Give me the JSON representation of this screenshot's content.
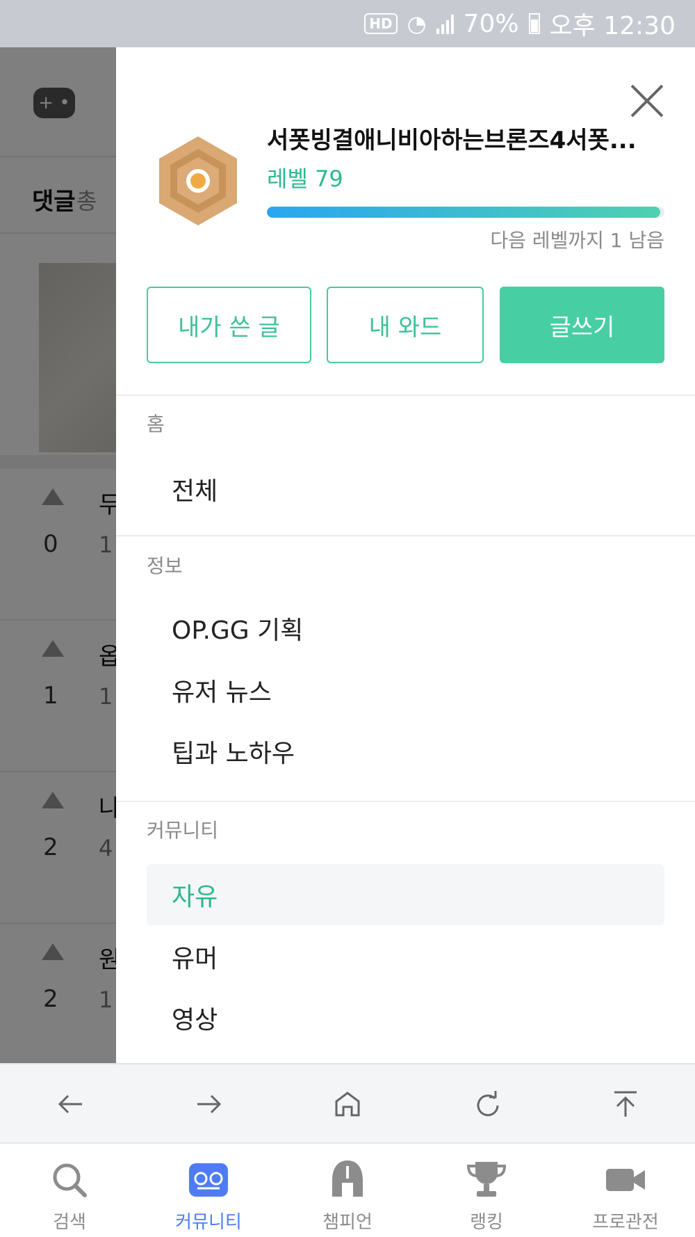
{
  "status_bar": {
    "hd": "HD",
    "battery": "70%",
    "time": "오후 12:30"
  },
  "background_page": {
    "comments_title": "댓글",
    "comments_sub": "총",
    "rows": [
      {
        "votes": "0",
        "title": "두",
        "meta": "1"
      },
      {
        "votes": "1",
        "title": "옵",
        "meta": "1"
      },
      {
        "votes": "2",
        "title": "나",
        "meta": "4"
      },
      {
        "votes": "2",
        "title": "원",
        "meta": "1"
      }
    ]
  },
  "drawer": {
    "username": "서폿빙결애니비아하는브론즈4서폿...",
    "level": "레벨 79",
    "progress_fraction": 0.99,
    "next_level": "다음 레벨까지 1 남음",
    "buttons": {
      "my_posts": "내가 쓴 글",
      "my_ward": "내 와드",
      "write": "글쓰기"
    },
    "sections": {
      "home": {
        "title": "홈",
        "items": [
          "전체"
        ]
      },
      "info": {
        "title": "정보",
        "items": [
          "OP.GG 기획",
          "유저 뉴스",
          "팁과 노하우"
        ]
      },
      "community": {
        "title": "커뮤니티",
        "items": [
          "자유",
          "유머",
          "영상"
        ],
        "active": "자유"
      }
    }
  },
  "browser_toolbar": {
    "icons": [
      "back-icon",
      "forward-icon",
      "home-icon",
      "refresh-icon",
      "scroll-top-icon"
    ]
  },
  "tabbar": {
    "tabs": [
      {
        "label": "검색",
        "icon": "search-icon"
      },
      {
        "label": "커뮤니티",
        "icon": "community-icon",
        "active": true
      },
      {
        "label": "챔피언",
        "icon": "champion-helmet-icon"
      },
      {
        "label": "랭킹",
        "icon": "trophy-icon"
      },
      {
        "label": "프로관전",
        "icon": "video-camera-icon"
      }
    ]
  },
  "colors": {
    "accent_green": "#48cea3",
    "active_blue": "#4f7cf5",
    "badge_orange": "#d8a46e"
  }
}
